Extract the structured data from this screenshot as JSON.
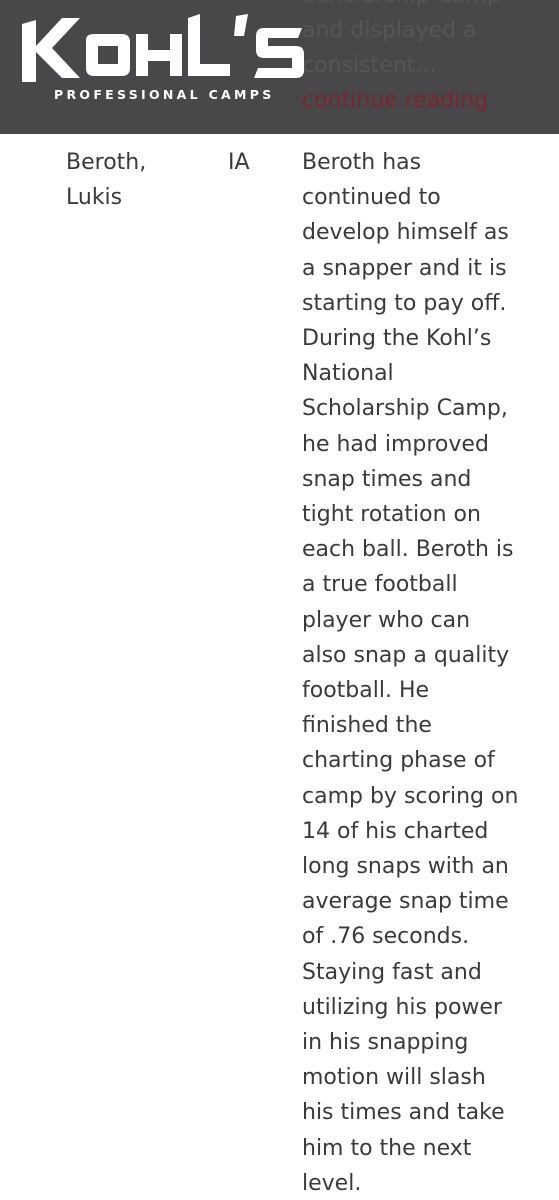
{
  "header": {
    "brand_name": "KOHL'S",
    "brand_tagline": "PROFESSIONAL CAMPS",
    "bg_color": "#3a3a3c"
  },
  "previous_entry": {
    "lines": [
      "Scholarship Camp",
      "and displayed a",
      "consistent..."
    ],
    "more_link": "continue reading",
    "link_color": "#8a1f2b"
  },
  "entry": {
    "name_line1": "Beroth,",
    "name_line2": "Lukis",
    "state": "IA",
    "description_lines": [
      "Beroth has",
      "continued to",
      "develop himself as",
      "a snapper and it is",
      "starting to pay off.",
      "During the Kohl’s",
      "National",
      "Scholarship Camp,",
      "he had improved",
      "snap times and",
      "tight rotation on",
      "each ball. Beroth is",
      "a true football",
      "player who can",
      "also snap a quality",
      "football. He",
      "finished the",
      "charting phase of",
      "camp by scoring on",
      "14 of his charted",
      "long snaps with an",
      "average snap time",
      "of .76 seconds.",
      "Staying fast and",
      "utilizing his power",
      "in his snapping",
      "motion will slash",
      "his times and take",
      "him to the next",
      "level."
    ]
  }
}
